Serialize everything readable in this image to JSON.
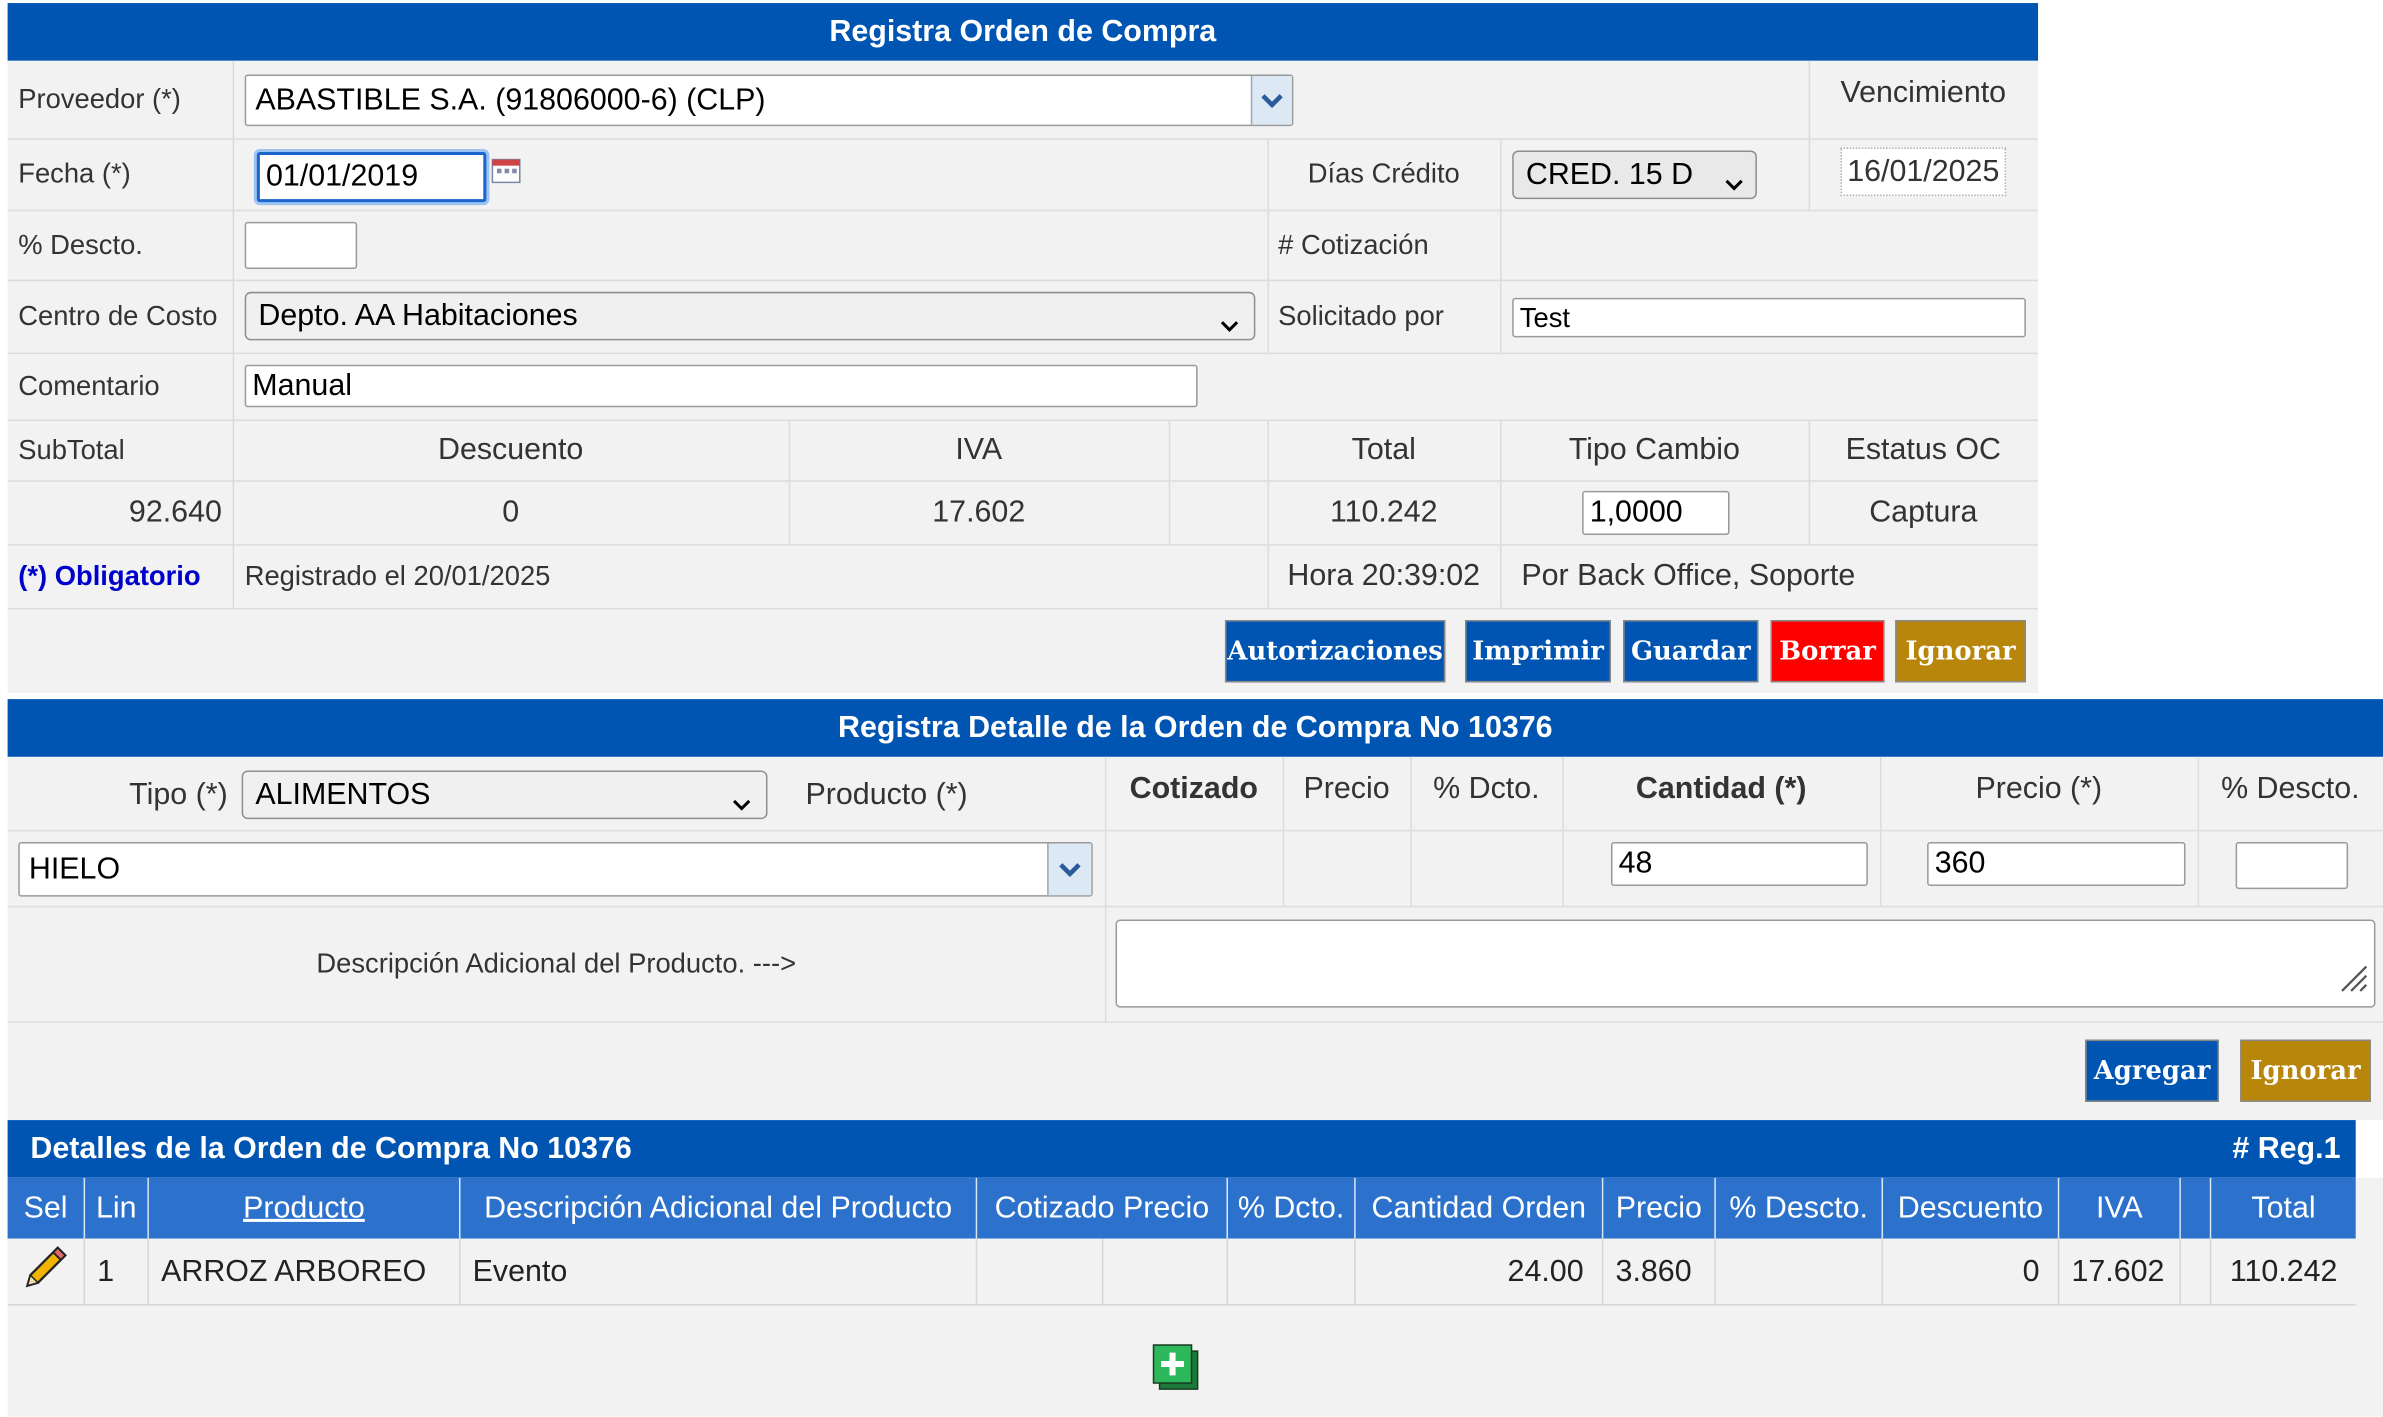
{
  "form": {
    "title": "Registra Orden de Compra",
    "proveedor_label": "Proveedor (*)",
    "proveedor_value": "ABASTIBLE S.A. (91806000-6) (CLP)",
    "vencimiento_label": "Vencimiento",
    "fecha_label": "Fecha (*)",
    "fecha_value": "01/01/2019",
    "dias_credito_label": "Días Crédito",
    "dias_credito_value": "CRED. 15 D",
    "vencimiento_value": "16/01/2025",
    "descto_label": "% Descto.",
    "descto_value": "",
    "cotizacion_label": "# Cotización",
    "centro_costo_label": "Centro de Costo",
    "centro_costo_value": "Depto. AA Habitaciones",
    "solicitado_label": "Solicitado por",
    "solicitado_value": "Test",
    "comentario_label": "Comentario",
    "comentario_value": "Manual"
  },
  "totals": {
    "subtotal_label": "SubTotal",
    "descuento_label": "Descuento",
    "iva_label": "IVA",
    "total_label": "Total",
    "tipo_cambio_label": "Tipo Cambio",
    "estatus_label": "Estatus OC",
    "subtotal": "92.640",
    "descuento": "0",
    "iva": "17.602",
    "total": "110.242",
    "tipo_cambio": "1,0000",
    "estatus": "Captura"
  },
  "footer": {
    "obligatorio": "(*) Obligatorio",
    "registrado": "Registrado el  20/01/2025",
    "hora": "Hora 20:39:02",
    "por": "Por Back Office, Soporte"
  },
  "buttons": {
    "autorizaciones": "Autorizaciones",
    "imprimir": "Imprimir",
    "guardar": "Guardar",
    "borrar": "Borrar",
    "ignorar": "Ignorar"
  },
  "detalle_form": {
    "title": "Registra Detalle de la Orden de Compra No 10376",
    "tipo_label": "Tipo (*)",
    "tipo_value": "ALIMENTOS",
    "producto_label": "Producto (*)",
    "cotizado_label": "Cotizado",
    "precio_label": "Precio",
    "dcto_label": "% Dcto.",
    "cantidad_label": "Cantidad (*)",
    "precio_req_label": "Precio (*)",
    "descto_label": "% Descto.",
    "producto_value": "HIELO",
    "cantidad_value": "48",
    "precio_value": "360",
    "descto_value": "",
    "desc_adicional_label": "Descripción Adicional del Producto. --->",
    "desc_adicional_value": "",
    "agregar": "Agregar",
    "ignorar": "Ignorar"
  },
  "detalles": {
    "title": "Detalles de la Orden de Compra No 10376",
    "reg": "# Reg.1",
    "columns": [
      "Sel",
      "Lin",
      "Producto",
      "Descripción Adicional del Producto",
      "Cotizado Precio",
      "% Dcto.",
      "Cantidad Orden",
      "Precio",
      "% Descto.",
      "Descuento",
      "IVA",
      "",
      "Total"
    ],
    "rows": [
      {
        "lin": "1",
        "producto": "ARROZ ARBOREO",
        "descripcion": "Evento",
        "cotizado": "",
        "dcto": "",
        "cantidad": "24.00",
        "precio": "3.860",
        "descto": "",
        "descuento": "0",
        "iva": "17.602",
        "extra": "",
        "total": "110.242"
      }
    ]
  },
  "colors": {
    "header_blue": "#0055b3",
    "table_header_blue": "#2c72cc",
    "borrar_red": "#ff0000",
    "ignorar_gold": "#b8860b",
    "obligatorio_blue": "#0000cc"
  },
  "icons": [
    "chevron-down-icon",
    "calendar-icon",
    "resize-handle-icon",
    "pencil-icon",
    "add-row-icon"
  ]
}
